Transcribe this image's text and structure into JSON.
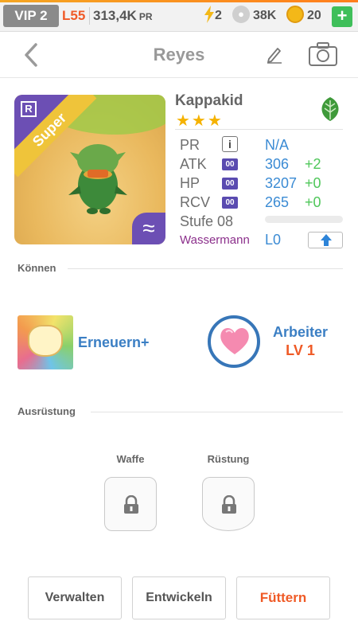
{
  "status": {
    "vip": "VIP 2",
    "level": "L55",
    "power": "313,4K",
    "power_unit": "PR",
    "energy": "2",
    "paws": "38K",
    "coins": "20",
    "plus": "+"
  },
  "header": {
    "title": "Reyes"
  },
  "monster": {
    "badge": "R",
    "rarity": "Super",
    "name": "Kappakid",
    "stars": "★★★",
    "element_icon": "leaf-icon",
    "stats": [
      {
        "label": "PR",
        "value": "N/A",
        "increment": ""
      },
      {
        "label": "ATK",
        "value": "306",
        "increment": "+2",
        "tag": "00"
      },
      {
        "label": "HP",
        "value": "3207",
        "increment": "+0",
        "tag": "00"
      },
      {
        "label": "RCV",
        "value": "265",
        "increment": "+0",
        "tag": "00"
      }
    ],
    "stage_label": "Stufe 08",
    "stage_progress": 0,
    "sign": "Wassermann",
    "sign_level": "L0",
    "wave_symbol": "≈"
  },
  "abilities": {
    "section": "Können",
    "skill_name": "Erneuern+",
    "job_name": "Arbeiter",
    "job_level": "LV 1"
  },
  "equipment": {
    "section": "Ausrüstung",
    "weapon": "Waffe",
    "armor": "Rüstung"
  },
  "actions": {
    "manage": "Verwalten",
    "evolve": "Entwickeln",
    "feed": "Füttern"
  },
  "colors": {
    "accent_blue": "#3b8bd4",
    "accent_orange": "#ef5a26",
    "increment_green": "#4fc75a",
    "rarity_purple": "#6c4fb4"
  }
}
